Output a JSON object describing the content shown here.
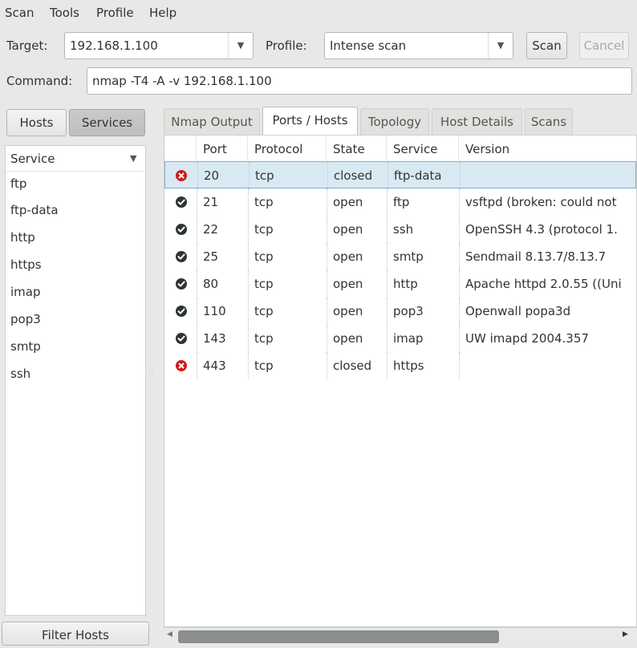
{
  "menubar": {
    "items": [
      "Scan",
      "Tools",
      "Profile",
      "Help"
    ]
  },
  "target": {
    "label": "Target:",
    "value": "192.168.1.100"
  },
  "profile": {
    "label": "Profile:",
    "value": "Intense scan"
  },
  "buttons": {
    "scan": "Scan",
    "cancel": "Cancel"
  },
  "command": {
    "label": "Command:",
    "value": "nmap -T4 -A -v 192.168.1.100"
  },
  "toggle": {
    "hosts": "Hosts",
    "services": "Services"
  },
  "left_list": {
    "header": "Service",
    "items": [
      "ftp",
      "ftp-data",
      "http",
      "https",
      "imap",
      "pop3",
      "smtp",
      "ssh"
    ]
  },
  "filter_button": "Filter Hosts",
  "tabs": [
    "Nmap Output",
    "Ports / Hosts",
    "Topology",
    "Host Details",
    "Scans"
  ],
  "table": {
    "columns": [
      "Port",
      "Protocol",
      "State",
      "Service",
      "Version"
    ],
    "rows": [
      {
        "status": "closed",
        "port": "20",
        "protocol": "tcp",
        "state": "closed",
        "service": "ftp-data",
        "version": ""
      },
      {
        "status": "open",
        "port": "21",
        "protocol": "tcp",
        "state": "open",
        "service": "ftp",
        "version": "vsftpd (broken: could not"
      },
      {
        "status": "open",
        "port": "22",
        "protocol": "tcp",
        "state": "open",
        "service": "ssh",
        "version": "OpenSSH 4.3 (protocol 1."
      },
      {
        "status": "open",
        "port": "25",
        "protocol": "tcp",
        "state": "open",
        "service": "smtp",
        "version": "Sendmail 8.13.7/8.13.7"
      },
      {
        "status": "open",
        "port": "80",
        "protocol": "tcp",
        "state": "open",
        "service": "http",
        "version": "Apache httpd 2.0.55 ((Uni"
      },
      {
        "status": "open",
        "port": "110",
        "protocol": "tcp",
        "state": "open",
        "service": "pop3",
        "version": "Openwall popa3d"
      },
      {
        "status": "open",
        "port": "143",
        "protocol": "tcp",
        "state": "open",
        "service": "imap",
        "version": "UW imapd 2004.357"
      },
      {
        "status": "closed",
        "port": "443",
        "protocol": "tcp",
        "state": "closed",
        "service": "https",
        "version": ""
      }
    ]
  },
  "icons": {
    "open": "check-icon",
    "closed": "error-x-icon"
  },
  "colors": {
    "open": "#2e3436",
    "closed": "#cc1b1b",
    "selection": "#d9e9f4"
  }
}
